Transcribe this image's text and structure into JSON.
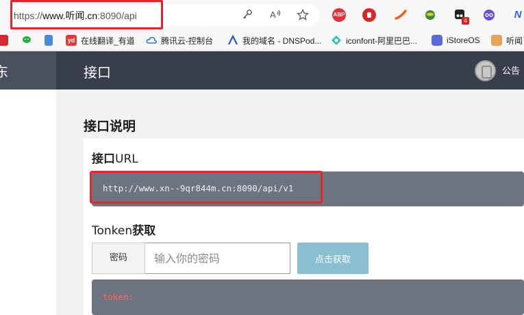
{
  "browser": {
    "edge_glyph": ")",
    "url_prefix": "https://",
    "url_domain": "www.听闻.cn",
    "url_rest": ":8090/api",
    "extensions": [
      {
        "icon": "adblock-plus-icon",
        "label": "ABP",
        "color": "#e0303a"
      },
      {
        "icon": "ublock-icon",
        "color": "#d42a25"
      },
      {
        "icon": "brush-extension-icon",
        "color": "#f08a3c"
      },
      {
        "icon": "globe-extension-icon",
        "color": "#3a8a3a"
      },
      {
        "icon": "tampermonkey-icon",
        "color": "#222222",
        "badge": "4"
      },
      {
        "icon": "owl-extension-icon",
        "color": "#6b4fd0"
      },
      {
        "icon": "n-extension-icon",
        "label": "N",
        "color": "#2a6ae0"
      }
    ]
  },
  "bookmarks": [
    {
      "icon": "seal-bookmark-icon",
      "label": "",
      "color": "#d22c2c"
    },
    {
      "icon": "wechat-icon",
      "label": "",
      "color": "#2aae3c"
    },
    {
      "icon": "mobile-bookmark-icon",
      "label": "",
      "color": "#4a8ad8"
    },
    {
      "icon": "youdao-icon",
      "label": "在线翻译_有道",
      "color": "#e53935",
      "glyph": "yd"
    },
    {
      "icon": "tencent-cloud-icon",
      "label": "腾讯云-控制台",
      "color": "#2a7ad8"
    },
    {
      "icon": "dnspod-icon",
      "label": "我的域名 - DNSPod...",
      "color": "#2355d8"
    },
    {
      "icon": "iconfont-icon",
      "label": "iconfont-阿里巴巴...",
      "color": "#2ac0c8"
    },
    {
      "icon": "istoreos-icon",
      "label": "iStoreOS",
      "color": "#5a6ad8"
    },
    {
      "icon": "tingwen-icon",
      "label": "听闻",
      "color": "#e8a25a"
    }
  ],
  "site": {
    "brand_fragment": "东",
    "header_title": "接口",
    "notice_label": "公告"
  },
  "doc": {
    "section_title": "接口说明",
    "url_label_cn": "接口",
    "url_label_en": "URL",
    "api_url": "http://www.xn--9qr844m.cn:8090/api/v1",
    "token_section_en": "Tonken",
    "token_section_cn": "获取",
    "password_label": "密码",
    "password_placeholder": "输入你的密码",
    "get_button": "点击获取",
    "token_output_label": "token:"
  }
}
